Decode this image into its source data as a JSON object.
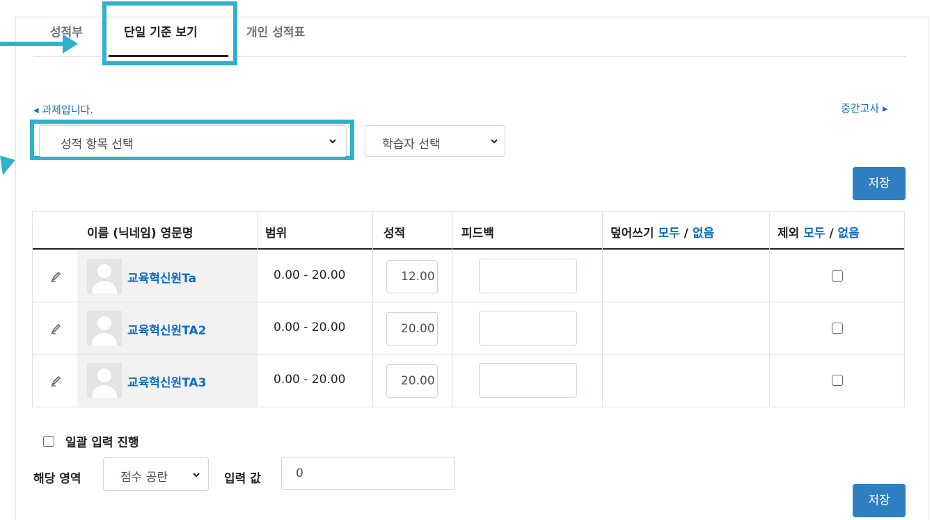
{
  "tabs": [
    {
      "label": "성적부"
    },
    {
      "label": "단일 기준 보기"
    },
    {
      "label": "개인 성적표"
    }
  ],
  "nav": {
    "prev": "◂ 과제입니다.",
    "next": "중간고사 ▸"
  },
  "selects": {
    "grade_item": "성적 항목 선택",
    "learner": "학습자 선택"
  },
  "save_label": "저장",
  "table": {
    "headers": {
      "name": "이름 (닉네임) 영문명",
      "range": "범위",
      "grade": "성적",
      "feedback": "피드백",
      "override": "덮어쓰기",
      "exclude": "제외",
      "all": "모두",
      "slash": " / ",
      "none": "없음"
    },
    "rows": [
      {
        "name": "교육혁신원Ta",
        "range": "0.00 - 20.00",
        "grade": "12.00"
      },
      {
        "name": "교육혁신원TA2",
        "range": "0.00 - 20.00",
        "grade": "20.00"
      },
      {
        "name": "교육혁신원TA3",
        "range": "0.00 - 20.00",
        "grade": "20.00"
      }
    ]
  },
  "bulk": {
    "label": "일괄 입력 진행",
    "area_label": "해당 영역",
    "area_value": "점수 공란",
    "value_label": "입력 값",
    "value": "0"
  },
  "colors": {
    "accent": "#2f7fc1",
    "link": "#0f6cbf",
    "annotation": "#2eb2cc"
  }
}
